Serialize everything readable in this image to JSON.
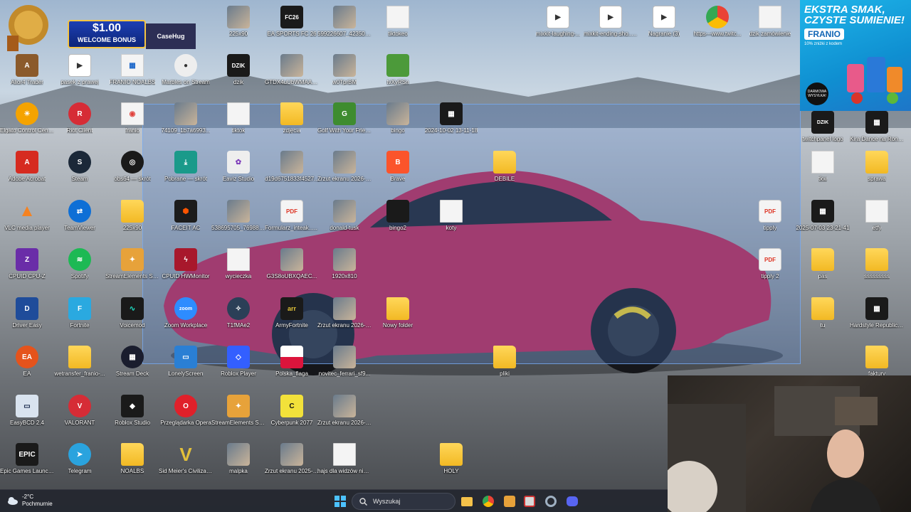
{
  "promo": {
    "amount": "$1.00",
    "bonus": "WELCOME BONUS",
    "brand": "CaseHug"
  },
  "ad": {
    "title": "EKSTRA SMAK, CZYSTE SUMIENIE!",
    "brand": "FRANIO",
    "sub": "10% zniżki z kodem",
    "badge": "DARMOWA WYSYŁKA!"
  },
  "icons": [
    {
      "label": "Alior4 Trader"
    },
    {
      "label": "pasek z prawej"
    },
    {
      "label": "FRANIO NOALBS"
    },
    {
      "label": "Marbles on Stream"
    },
    {
      "label": "dzik"
    },
    {
      "label": "GTDX4uUbWMAAo..."
    },
    {
      "label": "w0TprBM"
    },
    {
      "label": "tvXyRSn"
    },
    {
      "label": "Elgato Control Center"
    },
    {
      "label": "Riot Client"
    },
    {
      "label": "franio"
    },
    {
      "label": "74109_1b7a6993..."
    },
    {
      "label": "tiktok"
    },
    {
      "label": "zdjęcia"
    },
    {
      "label": "Golf With Your Friends"
    },
    {
      "label": "bingo"
    },
    {
      "label": "2024-10-02 13-11-18"
    },
    {
      "label": "Adobe Acrobat"
    },
    {
      "label": "Steam"
    },
    {
      "label": "obs64 — skrót"
    },
    {
      "label": "Pobrane — skrót"
    },
    {
      "label": "Eaviz Studio"
    },
    {
      "label": "d19d6751833f4527..."
    },
    {
      "label": "Zrzut ekranu 2026-01-13 001232"
    },
    {
      "label": "Brave"
    },
    {
      "label": "DEBILE"
    },
    {
      "label": "VLC media player"
    },
    {
      "label": "TeamViewer"
    },
    {
      "label": "225x90"
    },
    {
      "label": "FACEIT AC"
    },
    {
      "label": "538695705_769881..."
    },
    {
      "label": "Formularz_inteak... (2)"
    },
    {
      "label": "donald-tusk"
    },
    {
      "label": "bingo2"
    },
    {
      "label": "koty"
    },
    {
      "label": "CPUID CPU-Z"
    },
    {
      "label": "Spotify"
    },
    {
      "label": "StreamElements SE.Live"
    },
    {
      "label": "CPUID HWMonitor"
    },
    {
      "label": "wycieczka"
    },
    {
      "label": "G3S8oUBXQAEC..."
    },
    {
      "label": "1920x810"
    },
    {
      "label": "Driver Easy"
    },
    {
      "label": "Fortnite"
    },
    {
      "label": "Voicemod"
    },
    {
      "label": "Zoom Workplace"
    },
    {
      "label": "T1fMAe2"
    },
    {
      "label": "ArmyFortnite"
    },
    {
      "label": "Zrzut ekranu 2026-01-17 192350"
    },
    {
      "label": "Nowy folder"
    },
    {
      "label": "EA"
    },
    {
      "label": "wetransfer_franio-..."
    },
    {
      "label": "Stream Deck"
    },
    {
      "label": "LonelyScreen"
    },
    {
      "label": "Roblox Player"
    },
    {
      "label": "Polska_flaga"
    },
    {
      "label": "novitec_ferrari_sf9..."
    },
    {
      "label": "pliki"
    },
    {
      "label": "EasyBCD 2.4"
    },
    {
      "label": "VALORANT"
    },
    {
      "label": "Roblox Studio"
    },
    {
      "label": "Przeglądarka Opera"
    },
    {
      "label": "StreamElements SE.Live"
    },
    {
      "label": "Cyberpunk 2077"
    },
    {
      "label": "Zrzut ekranu 2026-02-08 035433"
    },
    {
      "label": "Epic Games Launcher"
    },
    {
      "label": "Telegram"
    },
    {
      "label": "NOALBS"
    },
    {
      "label": "Sid Meier's Civilization V"
    },
    {
      "label": "malpka"
    },
    {
      "label": "Zrzut ekranu 2025-12-13 205224"
    },
    {
      "label": "hajs dla widzów nie otwierać"
    },
    {
      "label": "HOLY"
    },
    {
      "label": "225x90"
    },
    {
      "label": "EA SPORTS FC 26"
    },
    {
      "label": "599226607_423509..."
    },
    {
      "label": "tiktokeo"
    },
    {
      "label": "mixkit-laughing-..."
    },
    {
      "label": "mixkit-ending-sho... (mp3cut.net)"
    },
    {
      "label": "Nagranie (3)"
    },
    {
      "label": "https---www.twitc..."
    },
    {
      "label": "dzik zamówienie"
    },
    {
      "label": "twitchpanel logo"
    },
    {
      "label": "Kira Dance na Rondzie (online-vi..."
    },
    {
      "label": "tkw"
    },
    {
      "label": "sprawa"
    },
    {
      "label": "tipply"
    },
    {
      "label": "2025-07-03 23-21-41"
    },
    {
      "label": "etfy"
    },
    {
      "label": "tipply 2"
    },
    {
      "label": "pas"
    },
    {
      "label": "sssssssss"
    },
    {
      "label": "tu"
    },
    {
      "label": "Hardstyle Republic - Nervanen - One day"
    },
    {
      "label": "faktury"
    }
  ],
  "taskbar": {
    "temperature": "-2°C",
    "condition": "Pochmurnie",
    "search_placeholder": "Wyszukaj"
  }
}
